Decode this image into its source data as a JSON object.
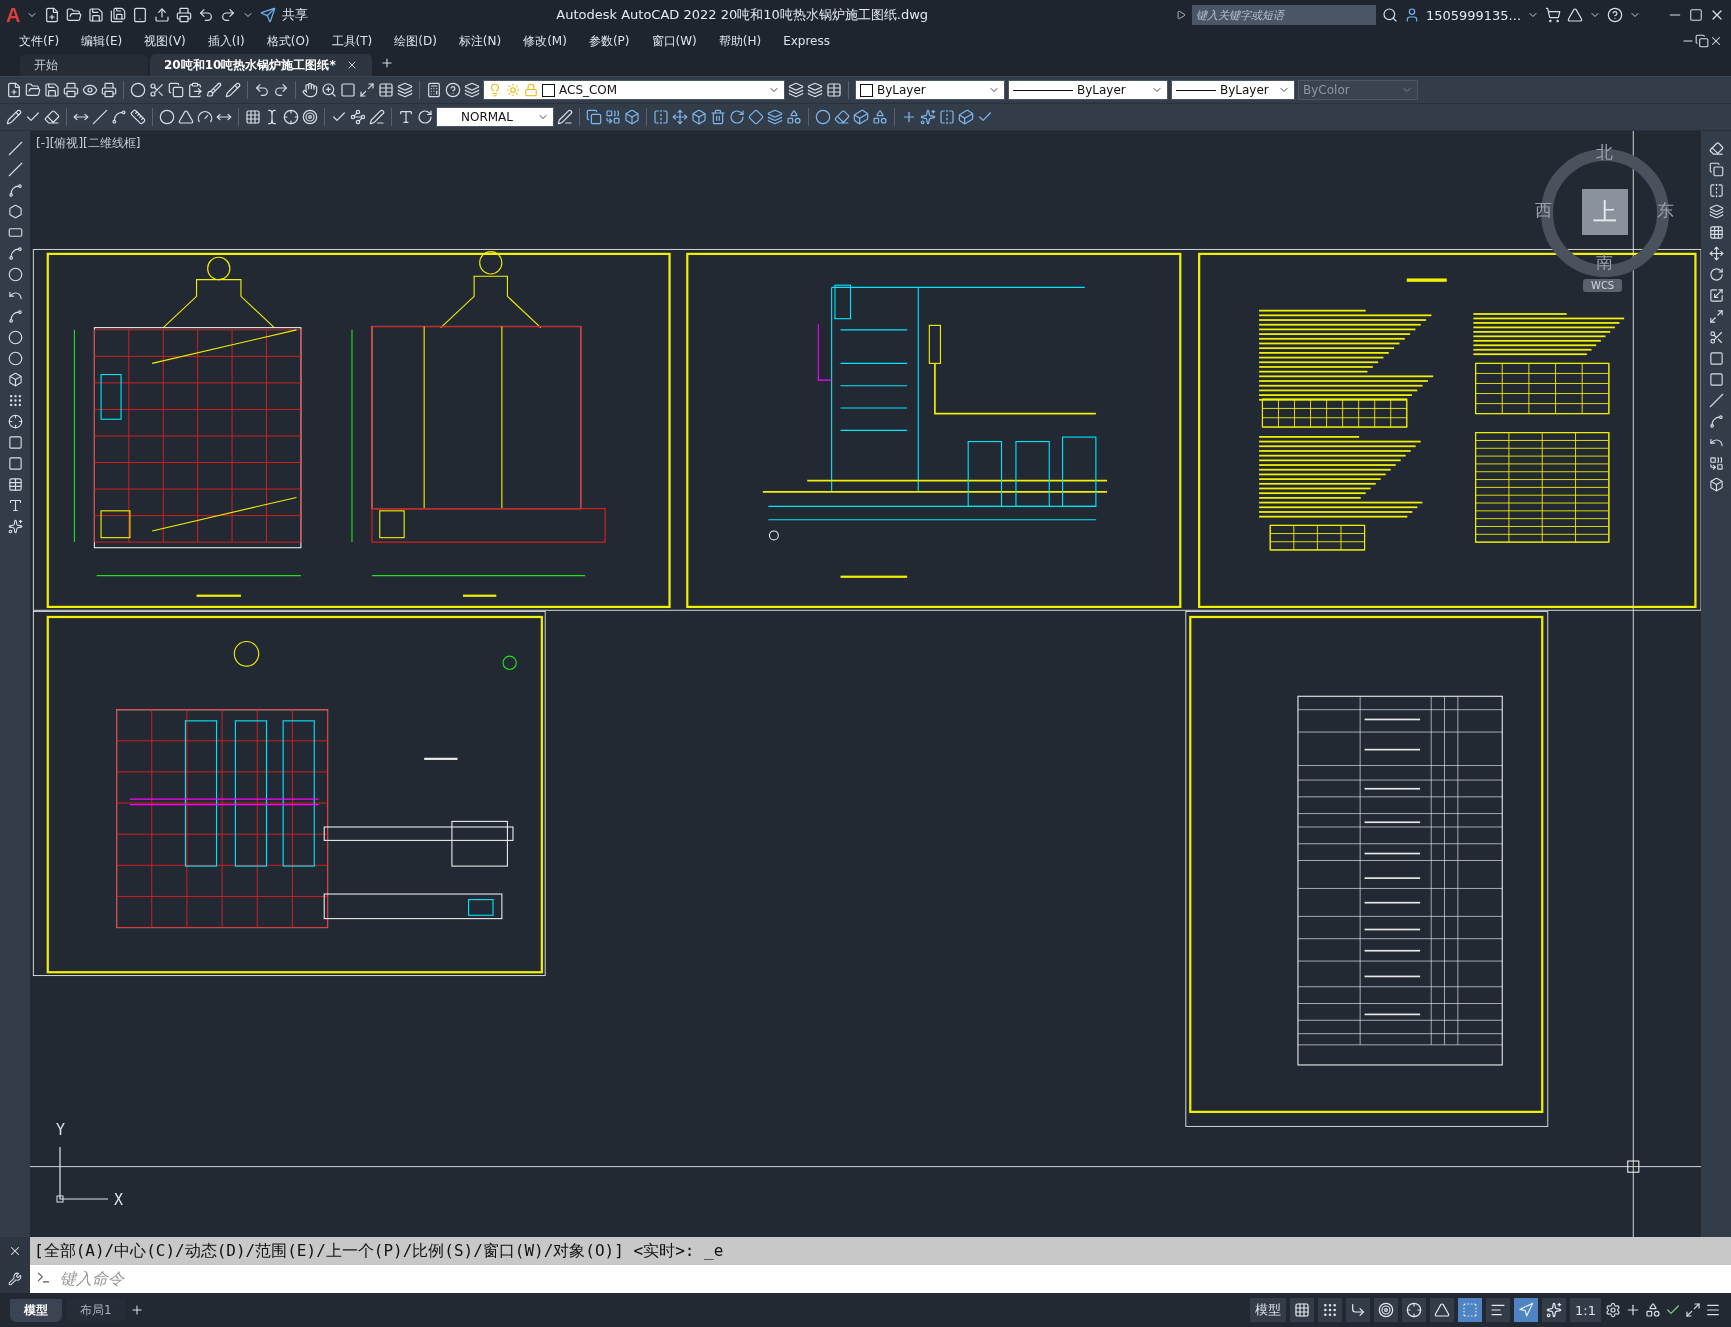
{
  "title_bar": {
    "logo": "A",
    "share_label": "共享",
    "app_name": "Autodesk AutoCAD 2022",
    "file_name": "20吨和10吨热水锅炉施工图纸.dwg",
    "search": {
      "placeholder": "键入关键字或短语"
    },
    "user": "1505999135..."
  },
  "menu": [
    "文件(F)",
    "编辑(E)",
    "视图(V)",
    "插入(I)",
    "格式(O)",
    "工具(T)",
    "绘图(D)",
    "标注(N)",
    "修改(M)",
    "参数(P)",
    "窗口(W)",
    "帮助(H)",
    "Express"
  ],
  "doc_tabs": [
    {
      "label": "开始",
      "selected": false
    },
    {
      "label": "20吨和10吨热水锅炉施工图纸*",
      "selected": true
    }
  ],
  "toolbar": {
    "layer": "ACS_COM",
    "color_control": "ByLayer",
    "linetype": "ByLayer",
    "lineweight": "ByLayer",
    "plot_style": {
      "label": "ByColor",
      "disabled": true
    },
    "text_style": "NORMAL"
  },
  "viewport": {
    "label": "[-][俯视][二维线框]",
    "viewcube": {
      "north": "北",
      "south": "南",
      "east": "东",
      "west": "西",
      "top": "上",
      "wcs": "WCS"
    },
    "ucs": {
      "x": "X",
      "y": "Y"
    }
  },
  "command": {
    "history": "[全部(A)/中心(C)/动态(D)/范围(E)/上一个(P)/比例(S)/窗口(W)/对象(O)] <实时>: _e",
    "placeholder": "键入命令"
  },
  "layout_tabs": [
    {
      "label": "模型",
      "selected": true
    },
    {
      "label": "布局1",
      "selected": false
    }
  ],
  "status_bar": {
    "space": "模型",
    "scale": "1:1",
    "toggles": [
      {
        "kind": "grid",
        "on": false
      },
      {
        "kind": "snap",
        "on": false
      },
      {
        "kind": "ortho",
        "on": false
      },
      {
        "kind": "polar",
        "on": false
      },
      {
        "kind": "osnap",
        "on": false
      },
      {
        "kind": "angle",
        "on": false
      },
      {
        "kind": "objsnap",
        "on": true
      },
      {
        "kind": "lineweight",
        "on": false
      },
      {
        "kind": "annotation",
        "on": true
      },
      {
        "kind": "autoscale",
        "on": false
      }
    ]
  }
}
